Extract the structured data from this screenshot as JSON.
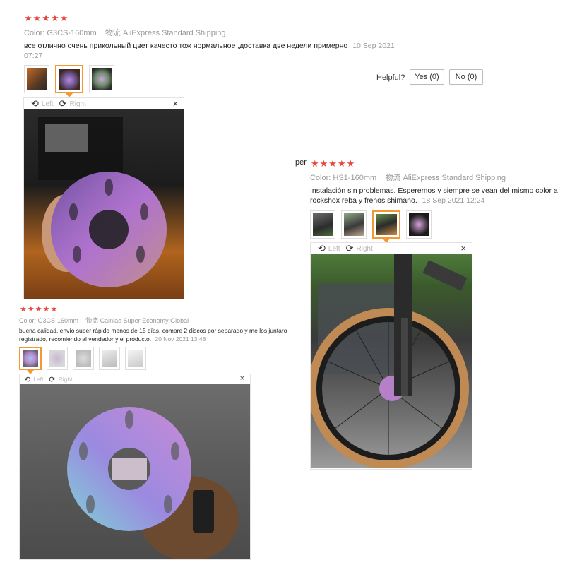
{
  "review1": {
    "stars": "★★★★★",
    "color_label": "Color:",
    "color_value": "G3CS-160mm",
    "ship_label": "物流",
    "ship_value": "AliExpress Standard Shipping",
    "text": "все отлично очень прикольный цвет качесто тож нормальное ,доставка две недели примерно",
    "date": "10 Sep 2021",
    "time": "07:27",
    "helpful_label": "Helpful?",
    "yes_label": "Yes (0)",
    "no_label": "No (0)",
    "viewer": {
      "left_label": "Left",
      "right_label": "Right",
      "close": "×"
    }
  },
  "review2": {
    "partial_prefix": "per",
    "stars": "★★★★★",
    "color_label": "Color:",
    "color_value": "HS1-160mm",
    "ship_label": "物流",
    "ship_value": "AliExpress Standard Shipping",
    "text_line1": "Instalación sin problemas. Esperemos y siempre se vean del mismo color a",
    "text_line2": "rockshox reba y frenos shimano.",
    "date": "18 Sep 2021 12:24",
    "viewer": {
      "left_label": "Left",
      "right_label": "Right",
      "close": "×"
    }
  },
  "review3": {
    "stars": "★★★★★",
    "color_label": "Color:",
    "color_value": "G3CS-160mm",
    "ship_label": "物流",
    "ship_value": "Cainiao Super Economy Global",
    "text_line1": "buena calidad, envío super rápido menos de 15 días, compre 2 discos por separado y me los juntaro",
    "text_line2": "registrado, recomiendo al vendedor y el producto.",
    "date": "20 Nov 2021 13:48",
    "viewer": {
      "left_label": "Left",
      "right_label": "Right",
      "close": "×"
    }
  },
  "colors": {
    "star": "#e8453c",
    "selected_thumb": "#f39833"
  }
}
